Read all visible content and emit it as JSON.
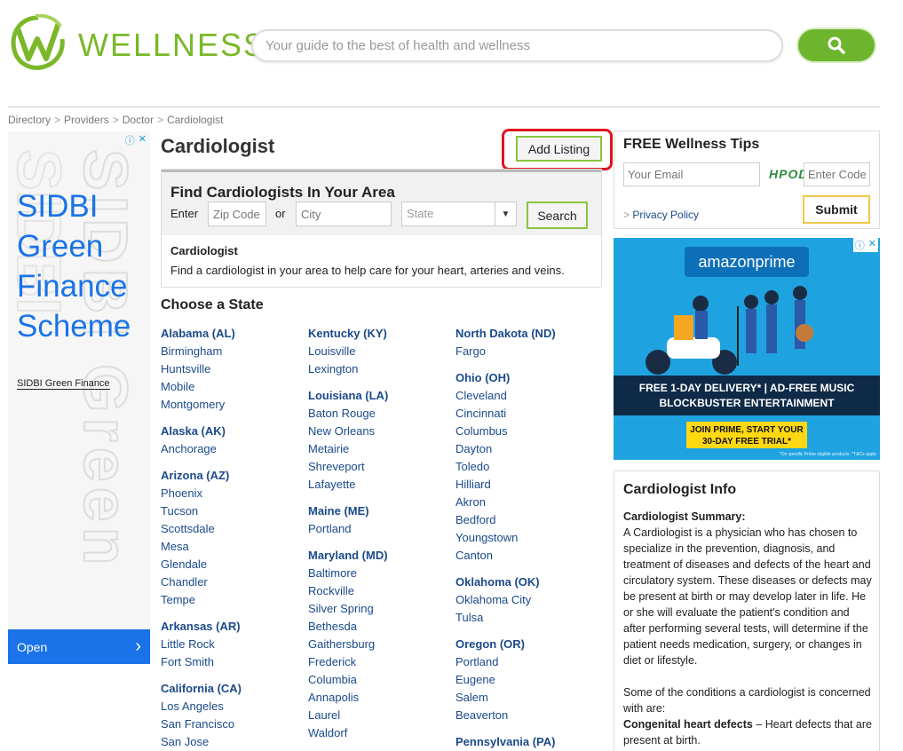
{
  "header": {
    "logo_text": "WELLNESS",
    "search_placeholder": "Your guide to the best of health and wellness",
    "brand_color": "#7ab829"
  },
  "breadcrumb": [
    "Directory",
    "Providers",
    "Doctor",
    "Cardiologist"
  ],
  "left_ad": {
    "headline": [
      "SIDBI",
      "Green",
      "Finance",
      "Scheme"
    ],
    "link": "SIDBI Green Finance",
    "open_label": "Open",
    "chevron": "›"
  },
  "main": {
    "title": "Cardiologist",
    "add_listing_label": "Add Listing",
    "find": {
      "title": "Find Cardiologists In Your Area",
      "enter_label": "Enter",
      "zip_placeholder": "Zip Code",
      "or_label": "or",
      "city_placeholder": "City",
      "state_placeholder": "State",
      "search_label": "Search",
      "sub_title": "Cardiologist",
      "description": "Find a cardiologist in your area to help care for your heart, arteries and veins."
    },
    "choose_state": "Choose a State",
    "columns": [
      [
        {
          "state": "Alabama (AL)",
          "cities": [
            "Birmingham",
            "Huntsville",
            "Mobile",
            "Montgomery"
          ]
        },
        {
          "state": "Alaska (AK)",
          "cities": [
            "Anchorage"
          ]
        },
        {
          "state": "Arizona (AZ)",
          "cities": [
            "Phoenix",
            "Tucson",
            "Scottsdale",
            "Mesa",
            "Glendale",
            "Chandler",
            "Tempe"
          ]
        },
        {
          "state": "Arkansas (AR)",
          "cities": [
            "Little Rock",
            "Fort Smith"
          ]
        },
        {
          "state": "California (CA)",
          "cities": [
            "Los Angeles",
            "San Francisco",
            "San Jose"
          ]
        }
      ],
      [
        {
          "state": "Kentucky (KY)",
          "cities": [
            "Louisville",
            "Lexington"
          ]
        },
        {
          "state": "Louisiana (LA)",
          "cities": [
            "Baton Rouge",
            "New Orleans",
            "Metairie",
            "Shreveport",
            "Lafayette"
          ]
        },
        {
          "state": "Maine (ME)",
          "cities": [
            "Portland"
          ]
        },
        {
          "state": "Maryland (MD)",
          "cities": [
            "Baltimore",
            "Rockville",
            "Silver Spring",
            "Bethesda",
            "Gaithersburg",
            "Frederick",
            "Columbia",
            "Annapolis",
            "Laurel",
            "Waldorf"
          ]
        }
      ],
      [
        {
          "state": "North Dakota (ND)",
          "cities": [
            "Fargo"
          ]
        },
        {
          "state": "Ohio (OH)",
          "cities": [
            "Cleveland",
            "Cincinnati",
            "Columbus",
            "Dayton",
            "Toledo",
            "Hilliard",
            "Akron",
            "Bedford",
            "Youngstown",
            "Canton"
          ]
        },
        {
          "state": "Oklahoma (OK)",
          "cities": [
            "Oklahoma City",
            "Tulsa"
          ]
        },
        {
          "state": "Oregon (OR)",
          "cities": [
            "Portland",
            "Eugene",
            "Salem",
            "Beaverton"
          ]
        },
        {
          "state": "Pennsylvania (PA)",
          "cities": []
        }
      ]
    ]
  },
  "tips": {
    "title": "FREE Wellness Tips",
    "email_placeholder": "Your Email",
    "captcha_text": "HPOD",
    "code_placeholder": "Enter Code",
    "privacy_prefix": ">",
    "privacy_label": "Privacy Policy",
    "submit_label": "Submit"
  },
  "amazon_ad": {
    "logo": "amazonprime",
    "band_line1": "FREE 1-DAY DELIVERY*  |  AD-FREE MUSIC",
    "band_line2": "BLOCKBUSTER ENTERTAINMENT",
    "cta_line1": "JOIN PRIME, START YOUR",
    "cta_line2": "30-DAY FREE TRIAL*",
    "fine_print": "*On specific Prime eligible products. *T&Cs apply"
  },
  "info": {
    "title": "Cardiologist Info",
    "summary_label": "Cardiologist Summary:",
    "summary_text": "A Cardiologist is a physician who has chosen to specialize in the prevention, diagnosis, and treatment of diseases and defects of the heart and circulatory system. These diseases or defects may be present at birth or may develop later in life. He or she will evaluate the patient's condition and after performing several tests, will determine if the patient needs medication, surgery, or changes in diet or lifestyle.",
    "conditions_intro": "Some of the conditions a cardiologist is concerned with are:",
    "condition1_label": "Congenital heart defects",
    "condition1_text": " – Heart defects that are present at birth."
  }
}
